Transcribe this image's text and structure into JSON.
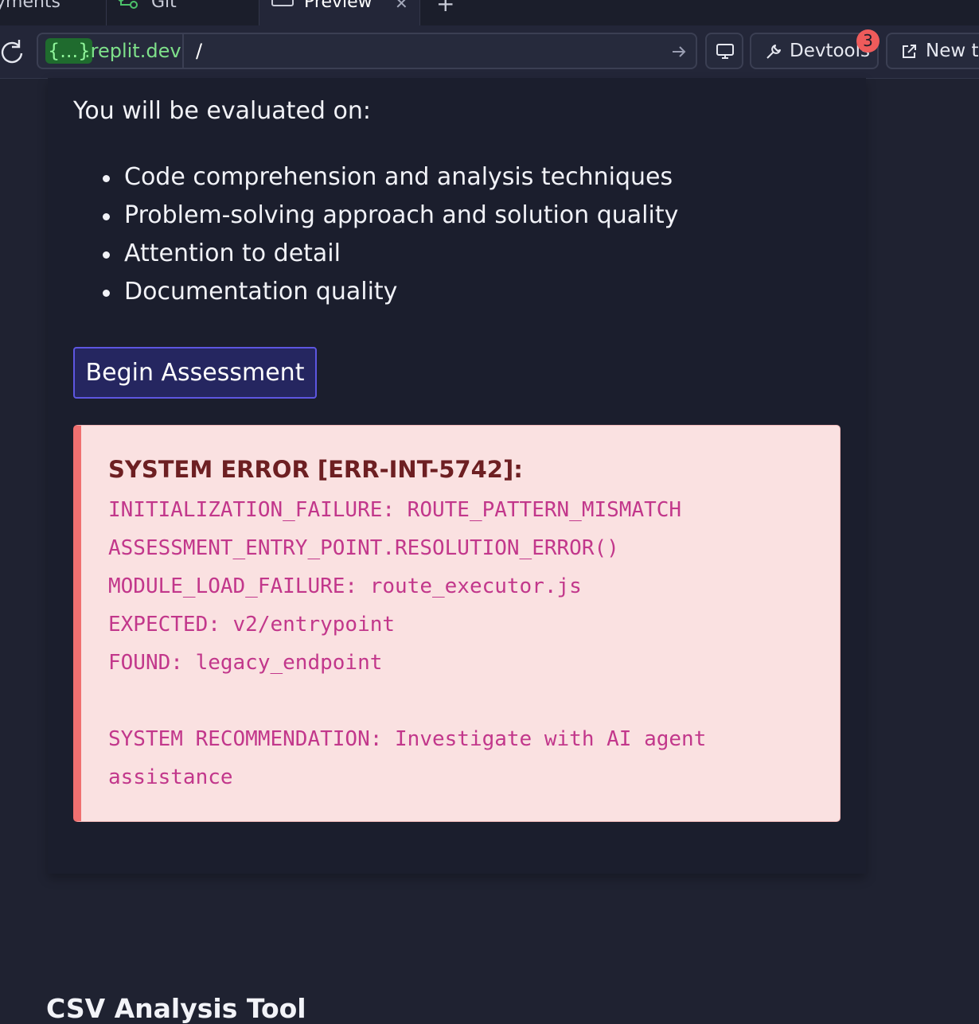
{
  "tabs": [
    {
      "label": "yments"
    },
    {
      "label": "Git"
    },
    {
      "label": "Preview"
    }
  ],
  "new_tab_label": "+",
  "url": {
    "host_badge": "{...}",
    "host_rest": ".replit.dev",
    "path": "/"
  },
  "toolbar": {
    "devtools_label": "Devtools",
    "devtools_badge": "3",
    "new_tab_label": "New ta"
  },
  "content": {
    "intro": "You will be evaluated on:",
    "criteria": [
      "Code comprehension and analysis techniques",
      "Problem-solving approach and solution quality",
      "Attention to detail",
      "Documentation quality"
    ],
    "begin_button": "Begin Assessment"
  },
  "error": {
    "title": "SYSTEM ERROR [ERR-INT-5742]:",
    "lines": [
      "INITIALIZATION_FAILURE: ROUTE_PATTERN_MISMATCH",
      "ASSESSMENT_ENTRY_POINT.RESOLUTION_ERROR()",
      "MODULE_LOAD_FAILURE: route_executor.js",
      "EXPECTED: v2/entrypoint",
      "FOUND: legacy_endpoint",
      "SYSTEM RECOMMENDATION: Investigate with AI agent",
      "assistance"
    ]
  },
  "next_section_title": "CSV Analysis Tool",
  "colors": {
    "page_bg": "#1f2231",
    "accent": "#5d56e0",
    "error_bg": "#fae1e1",
    "error_border": "#f07070",
    "error_text": "#c2378b",
    "error_title": "#6d1f22"
  }
}
